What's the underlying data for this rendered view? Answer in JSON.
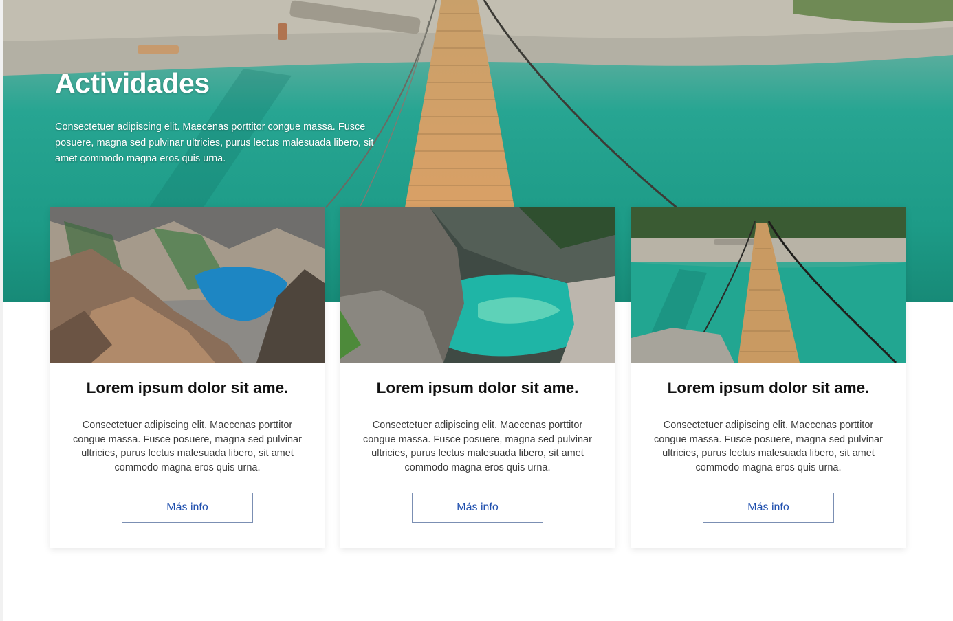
{
  "hero": {
    "title": "Actividades",
    "description": "Consectetuer adipiscing elit. Maecenas porttitor congue massa. Fusce posuere, magna sed pulvinar ultricies, purus lectus malesuada libero, sit amet commodo magna eros quis urna."
  },
  "cards": [
    {
      "image": "mountain-lake-photo",
      "title": "Lorem ipsum dolor sit ame.",
      "text": "Consectetuer adipiscing elit. Maecenas porttitor congue massa. Fusce posuere, magna sed pulvinar ultricies, purus lectus malesuada libero, sit amet commodo magna eros quis urna.",
      "button_label": "Más info"
    },
    {
      "image": "turquoise-river-canyon-photo",
      "title": "Lorem ipsum dolor sit ame.",
      "text": "Consectetuer adipiscing elit. Maecenas porttitor congue massa. Fusce posuere, magna sed pulvinar ultricies, purus lectus malesuada libero, sit amet commodo magna eros quis urna.",
      "button_label": "Más info"
    },
    {
      "image": "suspension-bridge-photo",
      "title": "Lorem ipsum dolor sit ame.",
      "text": "Consectetuer adipiscing elit. Maecenas porttitor congue massa. Fusce posuere, magna sed pulvinar ultricies, purus lectus malesuada libero, sit amet commodo magna eros quis urna.",
      "button_label": "Más info"
    }
  ],
  "colors": {
    "button_text": "#1f4fae",
    "button_border": "#7b8fb3",
    "water": "#1c9a86"
  }
}
